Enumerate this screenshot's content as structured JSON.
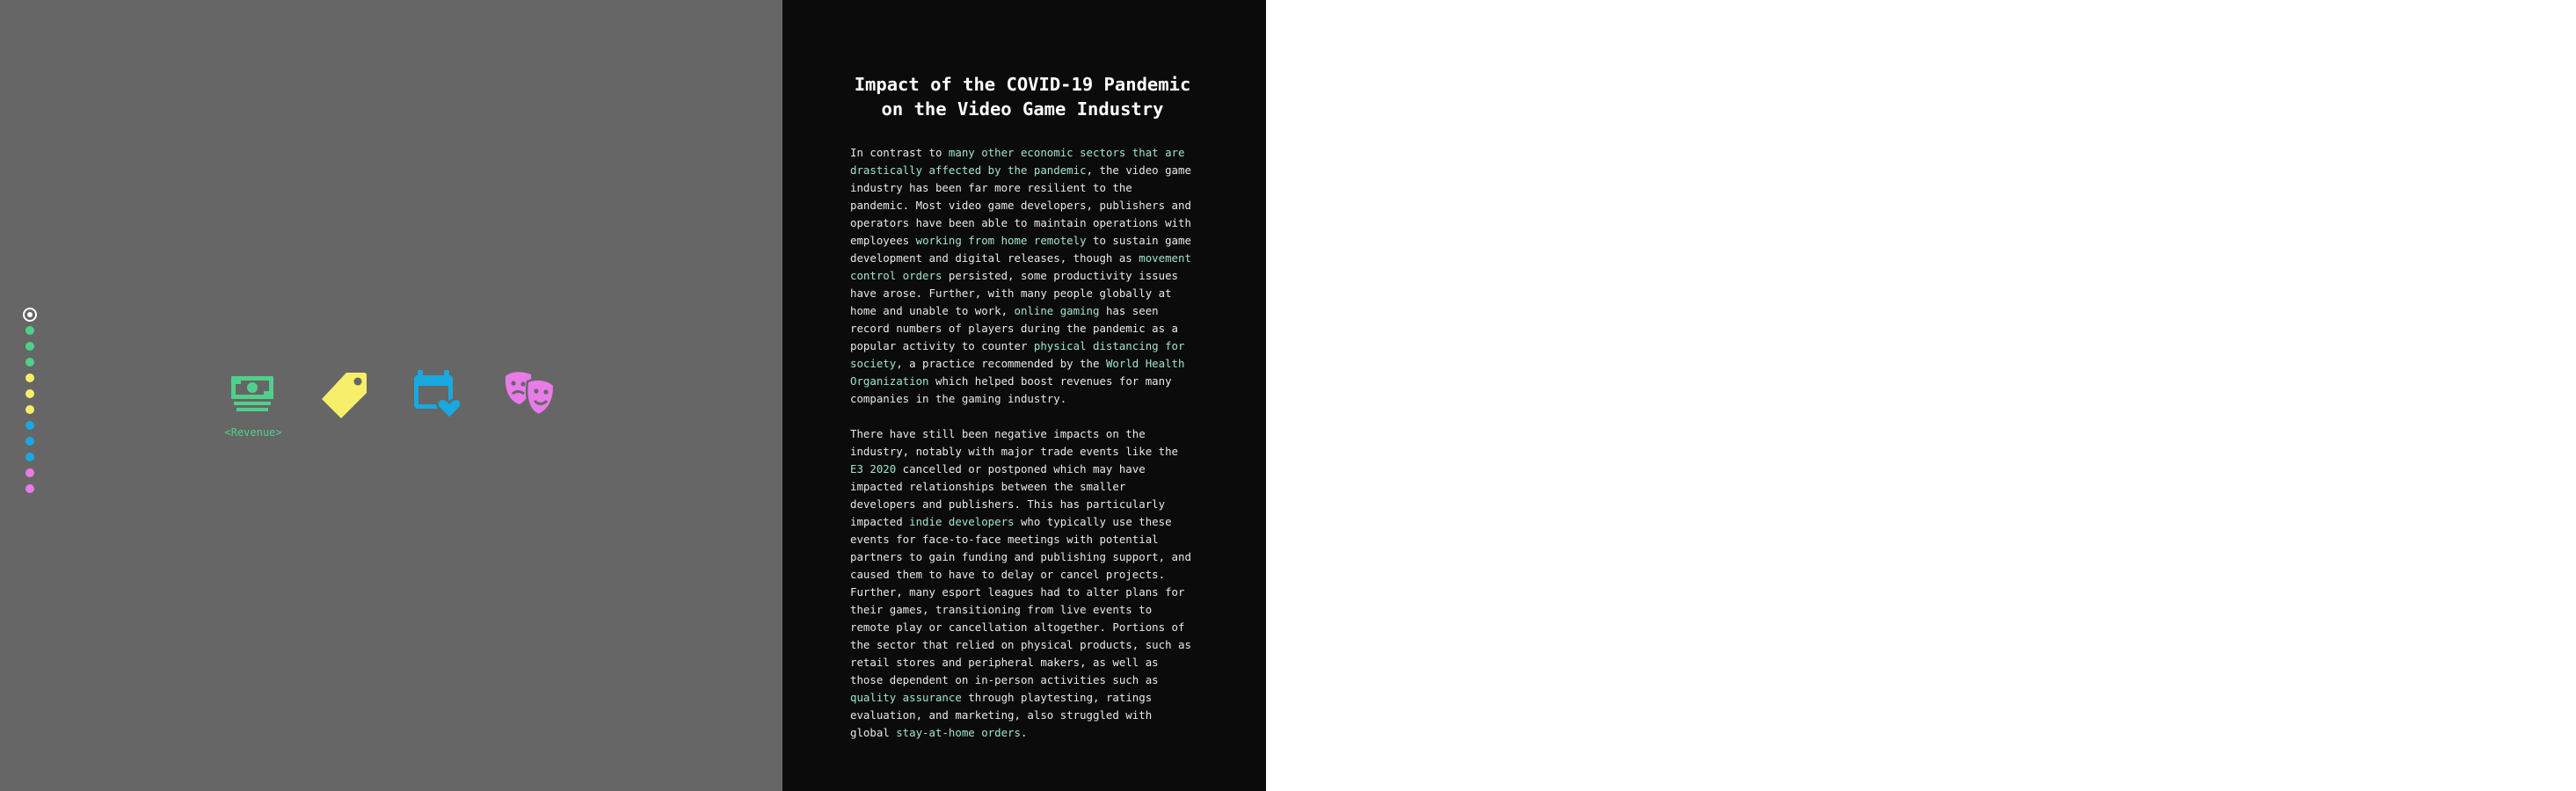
{
  "nav": {
    "dot_colors": [
      "#ffffff",
      "#4fd08a",
      "#4fd08a",
      "#4fd08a",
      "#f7ef6a",
      "#f7ef6a",
      "#f7ef6a",
      "#19a8e0",
      "#19a8e0",
      "#19a8e0",
      "#e87be8",
      "#e87be8"
    ],
    "active_index": 0
  },
  "icons": {
    "items": [
      {
        "name": "money-icon",
        "color": "#4fd08a"
      },
      {
        "name": "price-tag-icon",
        "color": "#f7ef6a"
      },
      {
        "name": "calendar-heart-icon",
        "color": "#19a8e0"
      },
      {
        "name": "theater-masks-icon",
        "color": "#e87be8"
      }
    ],
    "active_label": "<Revenue>"
  },
  "article": {
    "title": "Impact of the COVID-19 Pandemic on the Video Game Industry",
    "p1": [
      {
        "t": "In contrast to "
      },
      {
        "t": "many other economic sectors that are drastically affected by the pandemic",
        "link": true
      },
      {
        "t": ", the video game industry has been far more resilient to the pandemic. Most video game developers, publishers and operators have been able to maintain operations with employees "
      },
      {
        "t": "working from home remotely",
        "link": true
      },
      {
        "t": " to sustain game development and digital releases, though as "
      },
      {
        "t": "movement control orders",
        "link": true
      },
      {
        "t": " persisted, some productivity issues have arose. Further, with many people globally at home and unable to work, "
      },
      {
        "t": "online gaming",
        "link": true
      },
      {
        "t": " has seen record numbers of players during the pandemic as a popular activity to counter "
      },
      {
        "t": "physical distancing for society",
        "link": true
      },
      {
        "t": ", a practice recommended by the "
      },
      {
        "t": "World Health Organization",
        "link": true
      },
      {
        "t": " which helped boost revenues for many companies in the gaming industry."
      }
    ],
    "p2": [
      {
        "t": "There have still been negative impacts on the industry, notably with major trade events like the "
      },
      {
        "t": "E3 2020",
        "link": true
      },
      {
        "t": " cancelled or postponed which may have impacted relationships between the smaller developers and publishers. This has particularly impacted "
      },
      {
        "t": "indie developers",
        "link": true
      },
      {
        "t": " who typically use these events for face-to-face meetings with potential partners to gain funding and publishing support, and caused them to have to delay or cancel projects. Further, many esport leagues had to alter plans for their games, transitioning from live events to remote play or cancellation altogether. Portions of the sector that relied on physical products, such as retail stores and peripheral makers, as well as those dependent on in-person activities such as "
      },
      {
        "t": "quality assurance",
        "link": true
      },
      {
        "t": " through playtesting, ratings evaluation, and marketing, also struggled with global "
      },
      {
        "t": "stay-at-home orders",
        "link": true
      },
      {
        "t": "."
      }
    ]
  }
}
